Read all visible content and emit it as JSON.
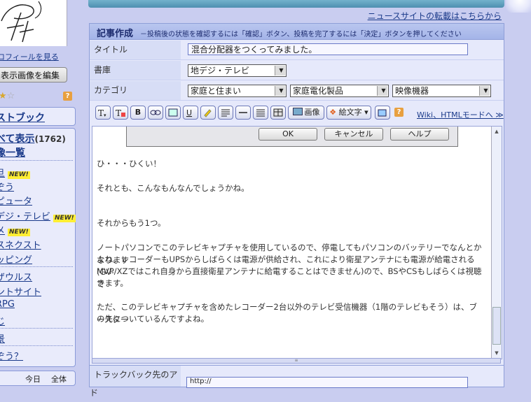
{
  "sidebar": {
    "profile_link": "ロフィールを見る",
    "edit_image_button": "表示画像を編集",
    "help_icon": "?",
    "guestbook_heading": "ストブック",
    "show_all_label": "べて表示",
    "show_all_count": "(1762)",
    "list_heading": "像一覧",
    "items": [
      {
        "label": "旦",
        "new": true
      },
      {
        "label": "ぞう",
        "new": false
      },
      {
        "label": "ピュータ",
        "new": false
      },
      {
        "label": "デジ・テレビ",
        "new": true
      },
      {
        "label": "メ",
        "new": true
      },
      {
        "label": "スネクスト",
        "new": false
      },
      {
        "label": "ッピング",
        "new": false
      },
      {
        "label": "ザウルス",
        "new": false
      },
      {
        "label": "ントサイト",
        "new": false
      },
      {
        "label": "RPG",
        "new": false
      },
      {
        "label": "じ",
        "new": false
      },
      {
        "label": "景",
        "new": false
      },
      {
        "label": "ぞう？",
        "new": false
      }
    ],
    "new_badge": "NEW!",
    "tab_today": "今日",
    "tab_all": "全体"
  },
  "header": {
    "news_link": "ニュースサイトの転載はこちらから"
  },
  "form": {
    "title": "記事作成",
    "hint": "－投稿後の状態を確認するには「確認」ボタン、投稿を完了するには「決定」ボタンを押してください",
    "title_label": "タイトル",
    "title_value": "混合分配器をつくってみました。",
    "shoko_label": "書庫",
    "shoko_value": "地デジ・テレビ",
    "category_label": "カテゴリ",
    "categories": [
      "家庭と住まい",
      "家庭電化製品",
      "映像機器"
    ]
  },
  "toolbar": {
    "image_label": "画像",
    "emoji_label": "絵文字",
    "help_icon": "?",
    "wiki_link": "Wiki、HTMLモードへ ≫"
  },
  "dialog": {
    "ok": "OK",
    "cancel": "キャンセル",
    "help": "ヘルプ"
  },
  "editor": {
    "lines": [
      "ひ・・・ひくい！",
      "それとも、こんなもんなんでしょうかね。",
      "それからもう1つ。",
      "ノートパソコンでこのテレビキャプチャを使用しているので、停電してもパソコンのバッテリーでなんとかなります",
      "よね。レコーダーもUPSからしばらくは電源が供給され、これにより衛星アンテナにも電源が給電される(GV-",
      "MVP/XZではこれ自身から直接衛星アンテナに給電することはできません)ので、BSやCSもしばらくは視聴で",
      "きます。",
      "ただ、このテレビキャプチャを含めたレコーダー2台以外のテレビ受信機器（1階のテレビもそう）は、ブースター",
      "の先についているんですよね。"
    ]
  },
  "trackback": {
    "label": "トラックバック先のアド",
    "value": "http://"
  }
}
